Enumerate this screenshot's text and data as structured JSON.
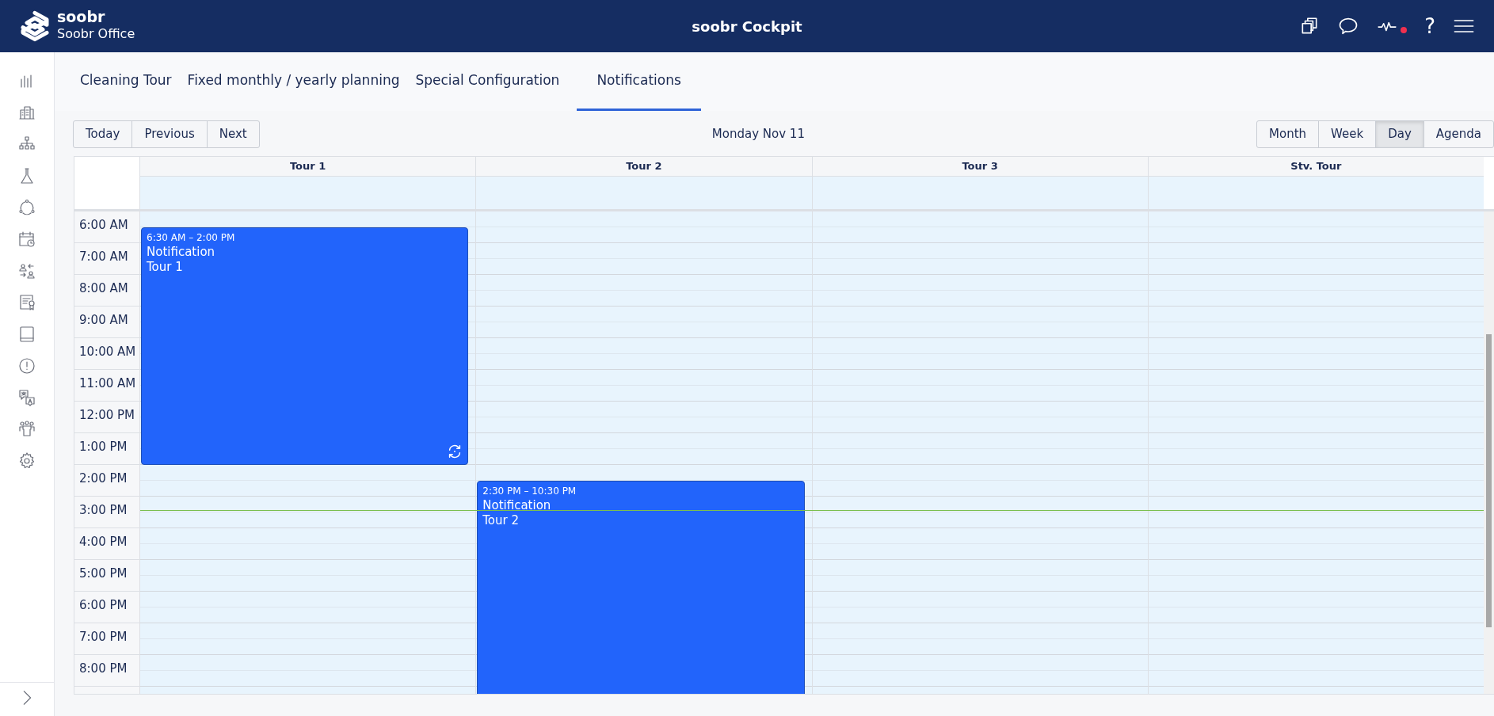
{
  "header": {
    "brand": "soobr",
    "subtitle": "Soobr Office",
    "title": "soobr Cockpit",
    "help": "?",
    "alert_dot": true
  },
  "tabs": [
    {
      "label": "Cleaning Tour",
      "selected": false
    },
    {
      "label": "Fixed monthly / yearly planning",
      "selected": false
    },
    {
      "label": "Special Configuration",
      "selected": false
    },
    {
      "label": "Notifications",
      "selected": true
    }
  ],
  "toolbar": {
    "nav_buttons": [
      "Today",
      "Previous",
      "Next"
    ],
    "date": "Monday Nov 11",
    "views": [
      {
        "label": "Month",
        "selected": false
      },
      {
        "label": "Week",
        "selected": false
      },
      {
        "label": "Day",
        "selected": true
      },
      {
        "label": "Agenda",
        "selected": false
      }
    ]
  },
  "calendar": {
    "time_slots": [
      "6:00 AM",
      "7:00 AM",
      "8:00 AM",
      "9:00 AM",
      "10:00 AM",
      "11:00 AM",
      "12:00 PM",
      "1:00 PM",
      "2:00 PM",
      "3:00 PM",
      "4:00 PM",
      "5:00 PM",
      "6:00 PM",
      "7:00 PM",
      "8:00 PM"
    ],
    "columns": [
      {
        "label": "Tour 1",
        "events": [
          {
            "time_range": "6:30 AM – 2:00 PM",
            "title": "Notification",
            "subtitle": "Tour 1",
            "recurring": true
          }
        ]
      },
      {
        "label": "Tour 2",
        "events": [
          {
            "time_range": "2:30 PM – 10:30 PM",
            "title": "Notification",
            "subtitle": "Tour 2"
          }
        ]
      },
      {
        "label": "Tour 3"
      },
      {
        "label": "Stv. Tour"
      }
    ]
  }
}
